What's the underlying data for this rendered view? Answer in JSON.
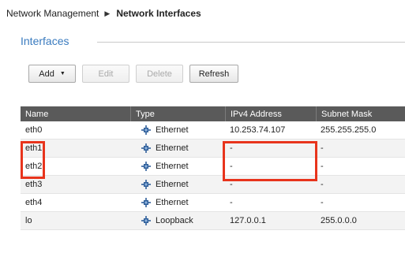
{
  "breadcrumb": {
    "parent": "Network Management",
    "current": "Network Interfaces"
  },
  "section": {
    "title": "Interfaces"
  },
  "toolbar": {
    "add": "Add",
    "edit": "Edit",
    "delete": "Delete",
    "refresh": "Refresh"
  },
  "table": {
    "columns": {
      "name": "Name",
      "type": "Type",
      "ipv4": "IPv4 Address",
      "mask": "Subnet Mask"
    },
    "rows": [
      {
        "name": "eth0",
        "type": "Ethernet",
        "ipv4": "10.253.74.107",
        "mask": "255.255.255.0"
      },
      {
        "name": "eth1",
        "type": "Ethernet",
        "ipv4": "-",
        "mask": "-"
      },
      {
        "name": "eth2",
        "type": "Ethernet",
        "ipv4": "-",
        "mask": "-"
      },
      {
        "name": "eth3",
        "type": "Ethernet",
        "ipv4": "-",
        "mask": "-"
      },
      {
        "name": "eth4",
        "type": "Ethernet",
        "ipv4": "-",
        "mask": "-"
      },
      {
        "name": "lo",
        "type": "Loopback",
        "ipv4": "127.0.0.1",
        "mask": "255.0.0.0"
      }
    ]
  },
  "icons": {
    "type_icon": "network-node-icon",
    "dropdown": "triangle-down-icon",
    "breadcrumb_sep": "triangle-right-icon"
  },
  "colors": {
    "accent": "#3a7bbf",
    "header_bg": "#5a5a5a",
    "highlight": "#e8341c",
    "icon": "#2f5f9a"
  }
}
